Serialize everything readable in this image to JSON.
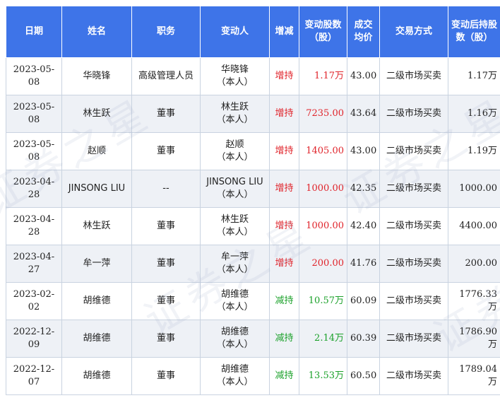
{
  "colors": {
    "header_bg": "#3e74e8",
    "increase": "#e0242b",
    "decrease": "#1ba12a"
  },
  "watermark": "证券之星",
  "headers": {
    "date": "日期",
    "name": "姓名",
    "role": "职务",
    "actor": "变动人",
    "direction": "增减",
    "shares": "变动股数（股）",
    "price": "成交均价",
    "method": "交易方式",
    "after": "变动后持股数（股）"
  },
  "rows": [
    {
      "date": "2023-05-08",
      "name": "华晓锋",
      "role": "高级管理人员",
      "actor_name": "华晓锋",
      "actor_rel": "（本人）",
      "direction": "增持",
      "dir_type": "increase",
      "shares": "1.17万",
      "price": "43.00",
      "method": "二级市场买卖",
      "after": "1.17万"
    },
    {
      "date": "2023-05-08",
      "name": "林生跃",
      "role": "董事",
      "actor_name": "林生跃",
      "actor_rel": "（本人）",
      "direction": "增持",
      "dir_type": "increase",
      "shares": "7235.00",
      "price": "43.64",
      "method": "二级市场买卖",
      "after": "1.16万"
    },
    {
      "date": "2023-05-08",
      "name": "赵顺",
      "role": "董事",
      "actor_name": "赵顺",
      "actor_rel": "（本人）",
      "direction": "增持",
      "dir_type": "increase",
      "shares": "1405.00",
      "price": "43.00",
      "method": "二级市场买卖",
      "after": "1.19万"
    },
    {
      "date": "2023-04-28",
      "name": "JINSONG LIU",
      "role": "--",
      "actor_name": "JINSONG LIU",
      "actor_rel": "（本人）",
      "direction": "增持",
      "dir_type": "increase",
      "shares": "1000.00",
      "price": "42.35",
      "method": "二级市场买卖",
      "after": "1000.00"
    },
    {
      "date": "2023-04-28",
      "name": "林生跃",
      "role": "董事",
      "actor_name": "林生跃",
      "actor_rel": "（本人）",
      "direction": "增持",
      "dir_type": "increase",
      "shares": "1000.00",
      "price": "42.40",
      "method": "二级市场买卖",
      "after": "4400.00"
    },
    {
      "date": "2023-04-27",
      "name": "牟一萍",
      "role": "董事",
      "actor_name": "牟一萍",
      "actor_rel": "（本人）",
      "direction": "增持",
      "dir_type": "increase",
      "shares": "200.00",
      "price": "41.76",
      "method": "二级市场买卖",
      "after": "200.00"
    },
    {
      "date": "2023-02-02",
      "name": "胡维德",
      "role": "董事",
      "actor_name": "胡维德",
      "actor_rel": "（本人）",
      "direction": "减持",
      "dir_type": "decrease",
      "shares": "10.57万",
      "price": "60.09",
      "method": "二级市场买卖",
      "after": "1776.33万"
    },
    {
      "date": "2022-12-09",
      "name": "胡维德",
      "role": "董事",
      "actor_name": "胡维德",
      "actor_rel": "（本人）",
      "direction": "减持",
      "dir_type": "decrease",
      "shares": "2.14万",
      "price": "60.39",
      "method": "二级市场买卖",
      "after": "1786.90万"
    },
    {
      "date": "2022-12-07",
      "name": "胡维德",
      "role": "董事",
      "actor_name": "胡维德",
      "actor_rel": "（本人）",
      "direction": "减持",
      "dir_type": "decrease",
      "shares": "13.53万",
      "price": "60.50",
      "method": "二级市场买卖",
      "after": "1789.04万"
    }
  ]
}
